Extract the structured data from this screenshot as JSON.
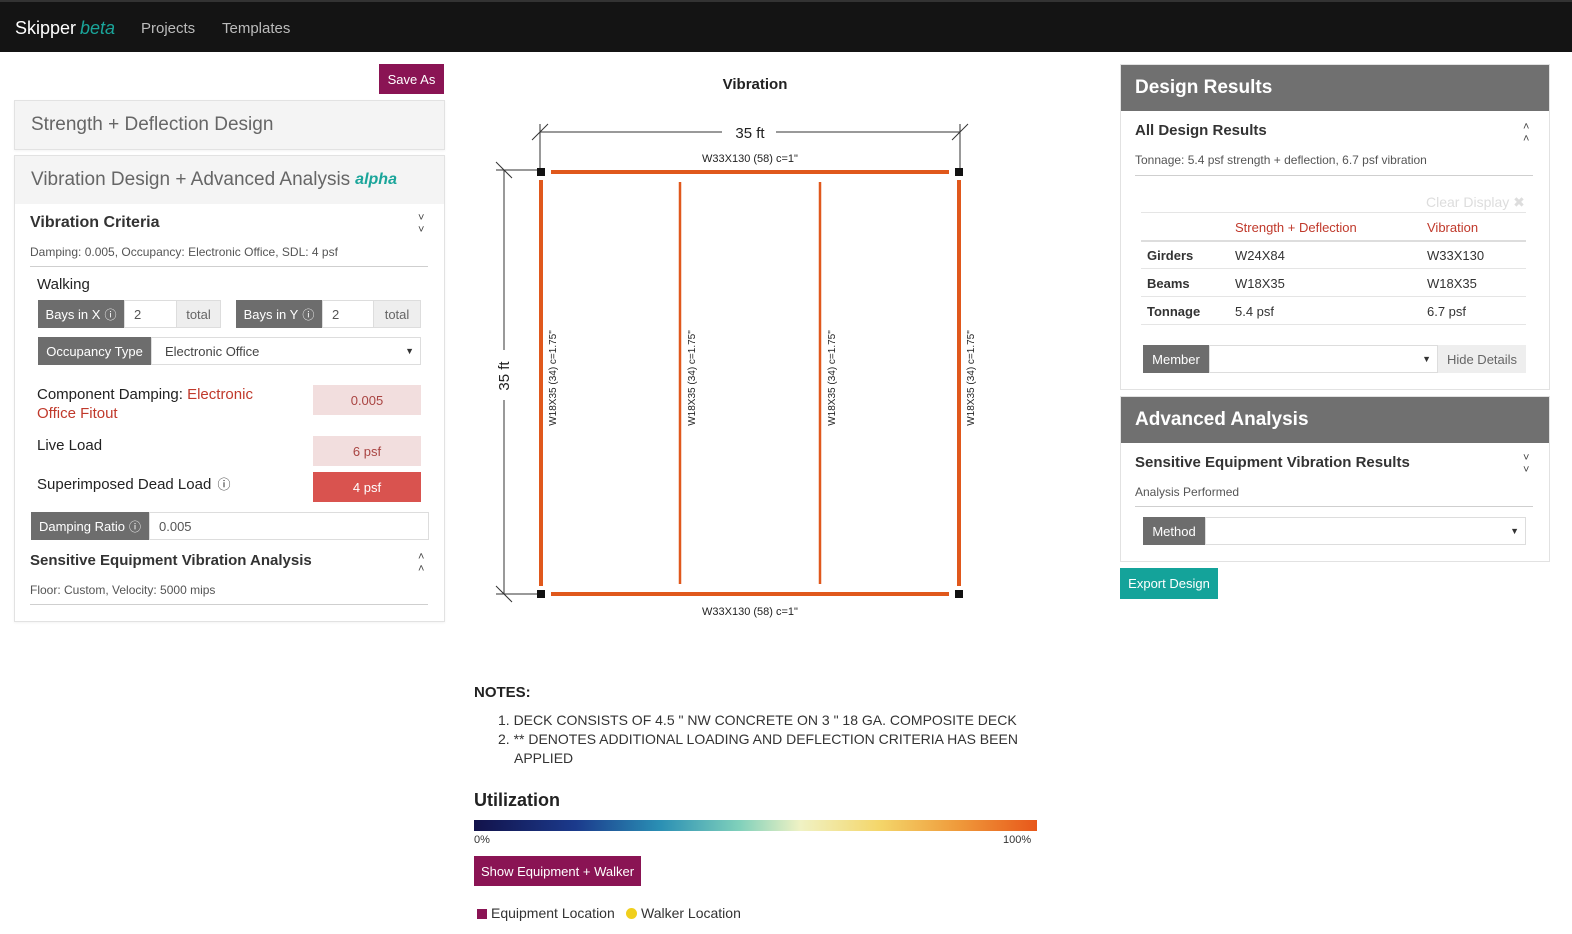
{
  "nav": {
    "brand": "Skipper",
    "brand_suffix": "beta",
    "links": [
      "Projects",
      "Templates"
    ]
  },
  "left": {
    "save_as": "Save As",
    "strength_title": "Strength + Deflection Design",
    "vibration_title": "Vibration Design + Advanced Analysis",
    "vibration_badge": "alpha",
    "criteria_title": "Vibration Criteria",
    "criteria_summary": "Damping: 0.005, Occupancy: Electronic Office, SDL: 4 psf",
    "walking_label": "Walking",
    "bays_x_label": "Bays in X",
    "bays_x_value": "2",
    "bays_y_label": "Bays in Y",
    "bays_y_value": "2",
    "total_label": "total",
    "occupancy_label": "Occupancy Type",
    "occupancy_value": "Electronic Office",
    "component_damping_label": "Component Damping:",
    "component_damping_link": "Electronic Office Fitout",
    "component_damping_value": "0.005",
    "live_load_label": "Live Load",
    "live_load_value": "6 psf",
    "sdl_label": "Superimposed Dead Load",
    "sdl_value": "4 psf",
    "damping_ratio_label": "Damping Ratio",
    "damping_ratio_value": "0.005",
    "sensitive_title": "Sensitive Equipment Vibration Analysis",
    "sensitive_summary": "Floor: Custom, Velocity: 5000 mips"
  },
  "plan": {
    "title": "Vibration",
    "dim_x": "35 ft",
    "dim_y": "35 ft",
    "girder_top": "W33X130 (58) c=1\"",
    "girder_bottom": "W33X130 (58) c=1\"",
    "beam_labels": [
      "W18X35 (34) c=1.75\"",
      "W18X35 (34) c=1.75\"",
      "W18X35 (34) c=1.75\"",
      "W18X35 (34) c=1.75\""
    ],
    "member_color": "#e0581c"
  },
  "notes": {
    "heading": "NOTES:",
    "items": [
      "1. DECK CONSISTS OF 4.5 \" NW CONCRETE ON 3 \" 18 GA. COMPOSITE DECK",
      "2. ** DENOTES ADDITIONAL LOADING AND DEFLECTION CRITERIA HAS BEEN",
      "APPLIED"
    ]
  },
  "utilization": {
    "heading": "Utilization",
    "min_label": "0%",
    "max_label": "100%",
    "show_button": "Show Equipment + Walker",
    "legend_equipment": "Equipment Location",
    "legend_walker": "Walker Location"
  },
  "results": {
    "header": "Design Results",
    "all_title": "All Design Results",
    "tonnage_summary": "Tonnage: 5.4 psf strength + deflection, 6.7 psf vibration",
    "clear_display": "Clear Display",
    "col_strength": "Strength + Deflection",
    "col_vibration": "Vibration",
    "rows": [
      {
        "name": "Girders",
        "strength": "W24X84",
        "vibration": "W33X130"
      },
      {
        "name": "Beams",
        "strength": "W18X35",
        "vibration": "W18X35"
      },
      {
        "name": "Tonnage",
        "strength": "5.4 psf",
        "vibration": "6.7 psf"
      }
    ],
    "member_label": "Member",
    "hide_details": "Hide Details"
  },
  "advanced": {
    "header": "Advanced Analysis",
    "title": "Sensitive Equipment Vibration Results",
    "summary": "Analysis Performed",
    "method_label": "Method",
    "export": "Export Design"
  }
}
